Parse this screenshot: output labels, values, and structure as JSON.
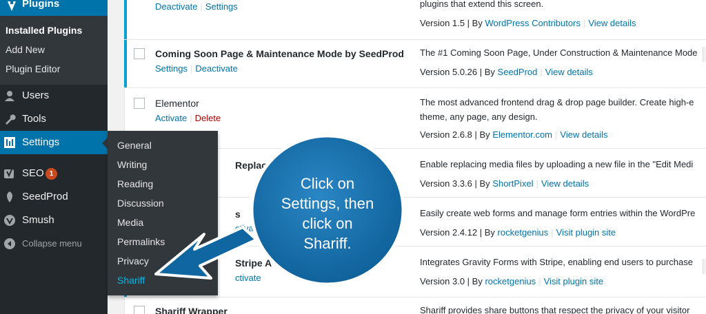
{
  "sidebar": {
    "plugins_label": "Plugins",
    "plugins_submenu": [
      "Installed Plugins",
      "Add New",
      "Plugin Editor"
    ],
    "menu": {
      "users": "Users",
      "tools": "Tools",
      "settings": "Settings",
      "seo": "SEO",
      "seo_badge": "1",
      "seedprod": "SeedProd",
      "smush": "Smush",
      "collapse": "Collapse menu"
    }
  },
  "flyout": {
    "items": [
      "General",
      "Writing",
      "Reading",
      "Discussion",
      "Media",
      "Permalinks",
      "Privacy",
      "Shariff"
    ]
  },
  "plugins": [
    {
      "name": "",
      "actions": [
        "Deactivate",
        "Settings"
      ],
      "description": "plugins that extend this screen.",
      "version": "Version 1.5",
      "by": "WordPress Contributors",
      "extra": "View details"
    },
    {
      "name": "Coming Soon Page & Maintenance Mode by SeedProd",
      "actions": [
        "Settings",
        "Deactivate"
      ],
      "description": "The #1 Coming Soon Page, Under Construction & Maintenance Mode",
      "version": "Version 5.0.26",
      "by": "SeedProd",
      "extra": "View details"
    },
    {
      "name": "Elementor",
      "actions": [
        "Activate",
        "Delete"
      ],
      "description": "The most advanced frontend drag & drop page builder. Create high-e",
      "description2": "theme, any page, any design.",
      "version": "Version 2.6.8",
      "by": "Elementor.com",
      "extra": "View details"
    },
    {
      "name": "Replace",
      "description": "Enable replacing media files by uploading a new file in the \"Edit Medi",
      "version": "Version 3.3.6",
      "by": "ShortPixel",
      "extra": "View details"
    },
    {
      "name": "s",
      "actions": [
        "ctivate"
      ],
      "description": "Easily create web forms and manage form entries within the WordPre",
      "version": "Version 2.4.12",
      "by": "rocketgenius",
      "extra": "Visit plugin site"
    },
    {
      "name": "Stripe A",
      "actions": [
        "ctivate"
      ],
      "description": "Integrates Gravity Forms with Stripe, enabling end users to purchase",
      "version": "Version 3.0",
      "by": "rocketgenius",
      "extra": "Visit plugin site"
    },
    {
      "name": "Shariff Wrapper",
      "description": "Shariff provides share buttons that respect the privacy of your visitor"
    }
  ],
  "by_prefix": "| By",
  "callout": {
    "lines": [
      "Click on",
      "Settings, then",
      "click on",
      "Shariff."
    ]
  }
}
